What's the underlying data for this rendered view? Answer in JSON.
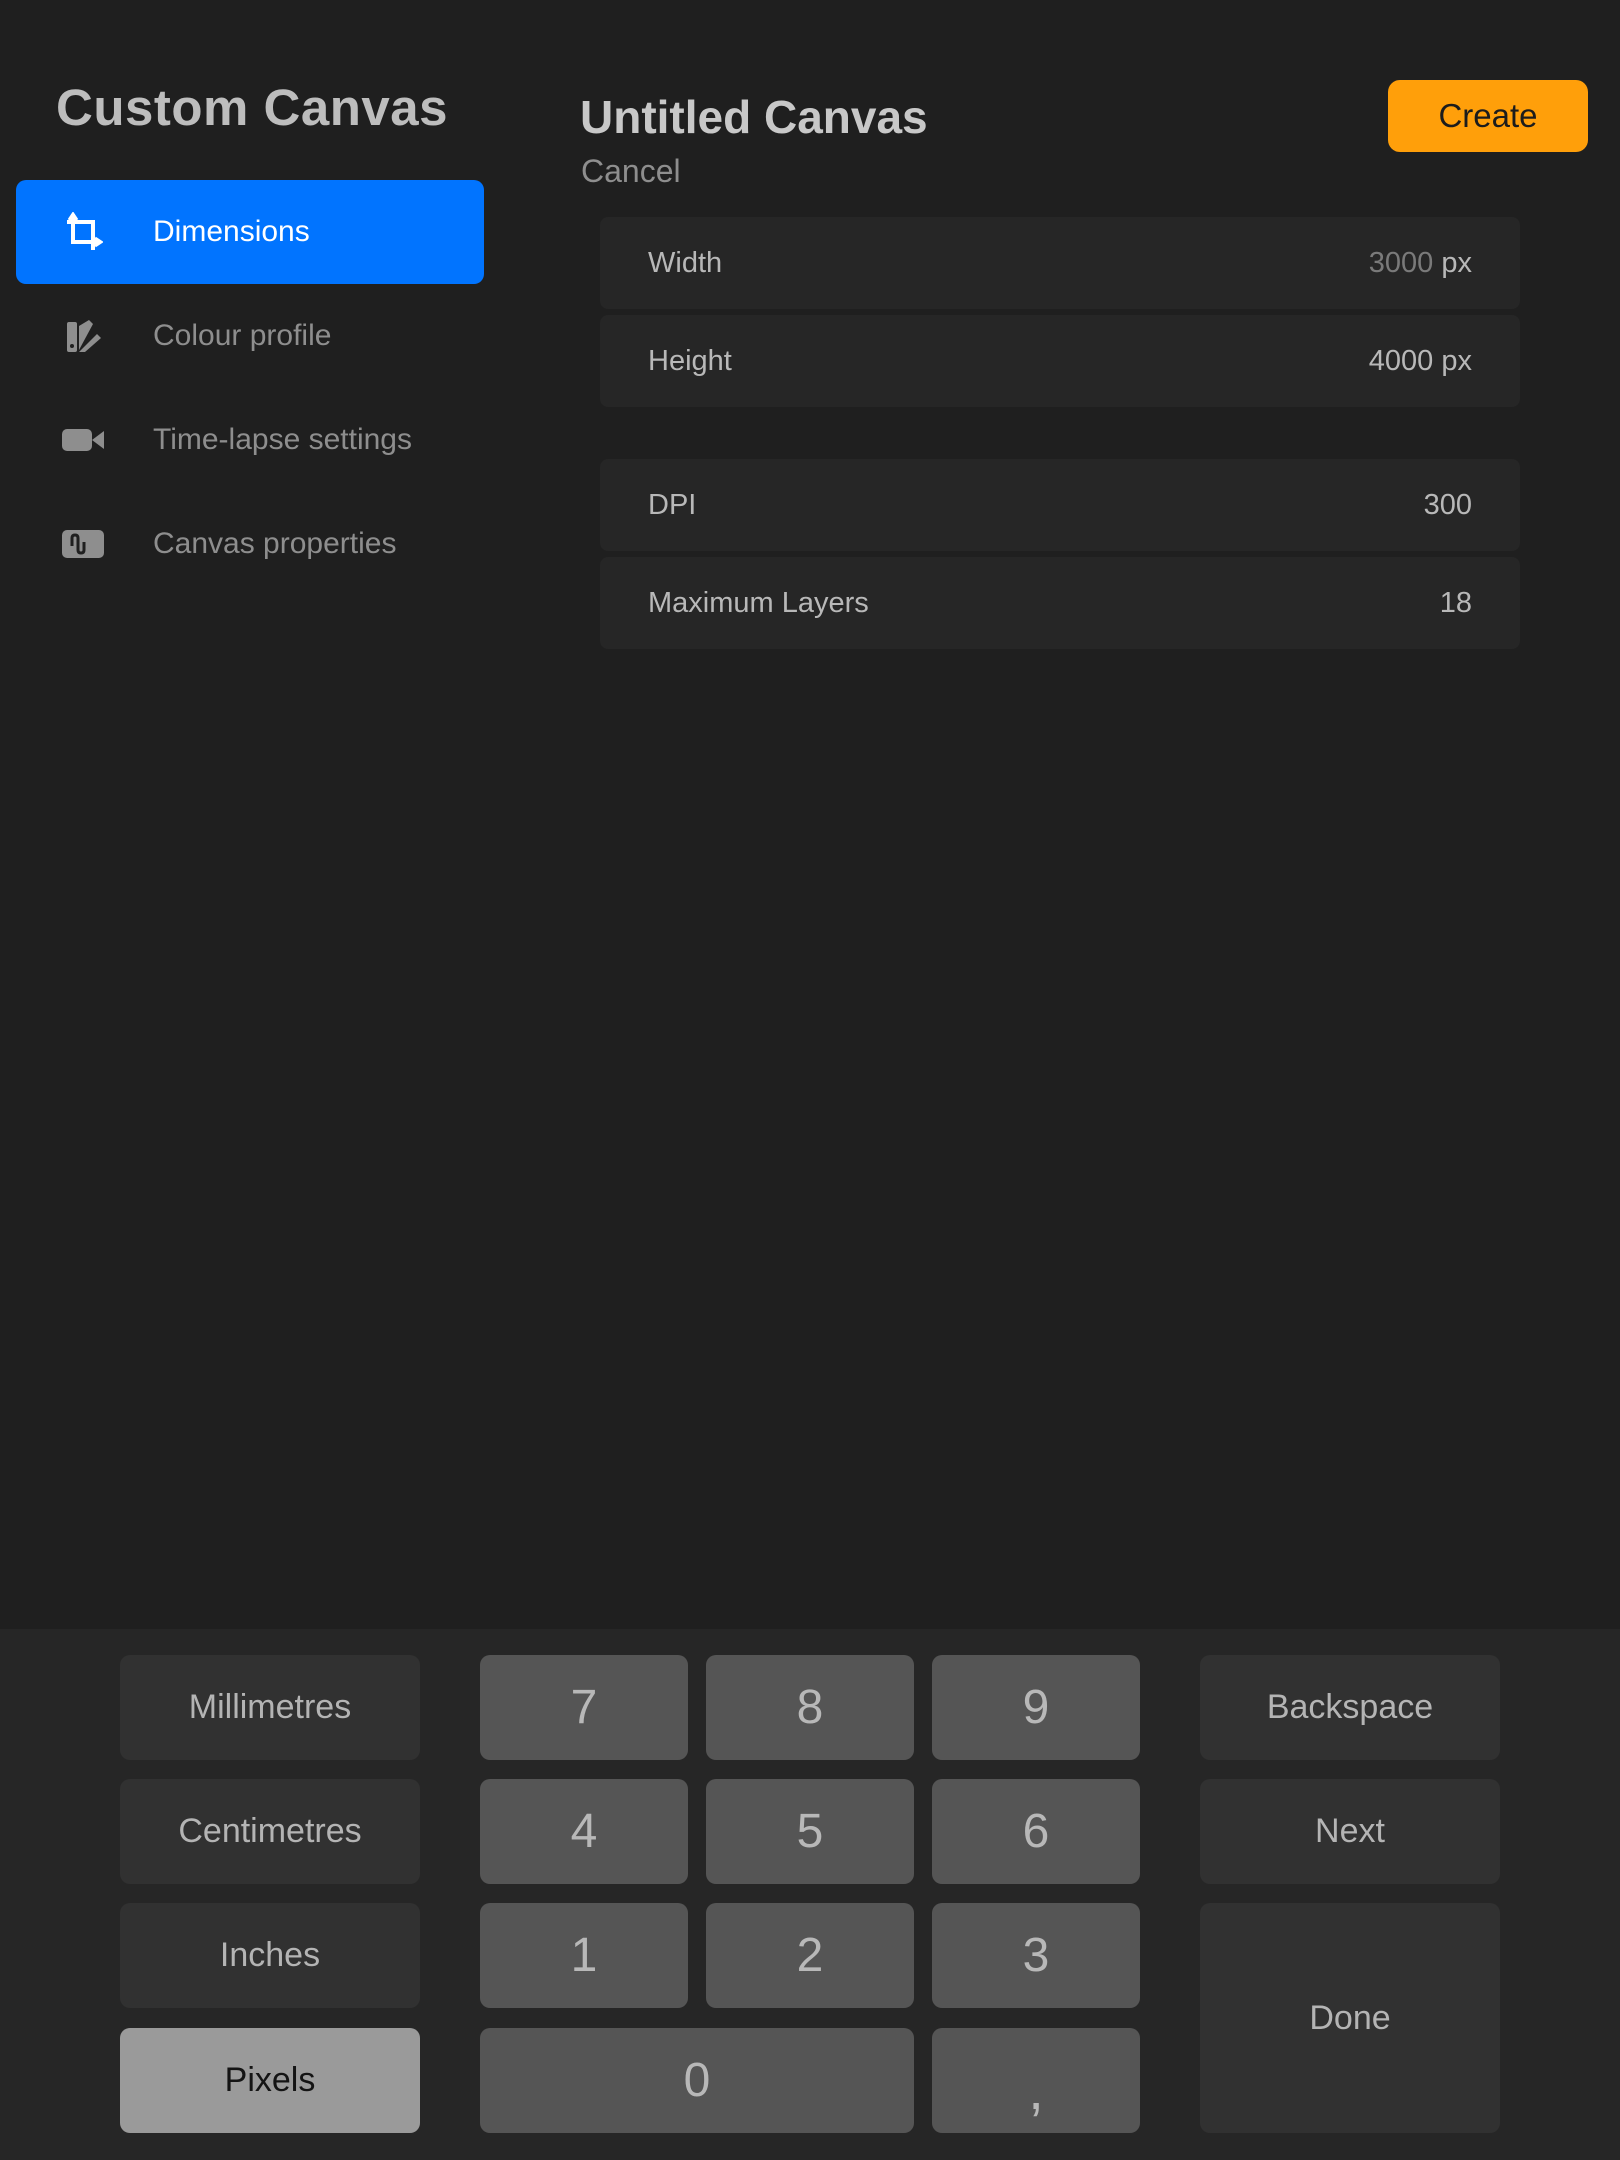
{
  "sidebar": {
    "title": "Custom Canvas",
    "items": [
      {
        "label": "Dimensions",
        "icon": "crop-icon",
        "active": true
      },
      {
        "label": "Colour profile",
        "icon": "swatch-fan-icon",
        "active": false
      },
      {
        "label": "Time-lapse settings",
        "icon": "video-camera-icon",
        "active": false
      },
      {
        "label": "Canvas properties",
        "icon": "waveform-icon",
        "active": false
      }
    ]
  },
  "header": {
    "title": "Untitled Canvas",
    "cancel_label": "Cancel",
    "create_label": "Create"
  },
  "fields": {
    "width": {
      "label": "Width",
      "value": "3000",
      "unit": "px"
    },
    "height": {
      "label": "Height",
      "value": "4000",
      "unit": "px"
    },
    "dpi": {
      "label": "DPI",
      "value": "300"
    },
    "max_layers": {
      "label": "Maximum Layers",
      "value": "18"
    }
  },
  "keyboard": {
    "units": [
      "Millimetres",
      "Centimetres",
      "Inches",
      "Pixels"
    ],
    "selected_unit": "Pixels",
    "digits": [
      "7",
      "8",
      "9",
      "4",
      "5",
      "6",
      "1",
      "2",
      "3",
      "0",
      ","
    ],
    "backspace_label": "Backspace",
    "next_label": "Next",
    "done_label": "Done"
  },
  "colors": {
    "background": "#1f1f1f",
    "accent": "#0174ff",
    "create_button": "#ff9f0a",
    "key_number": "#555555",
    "key_function": "#313131"
  }
}
